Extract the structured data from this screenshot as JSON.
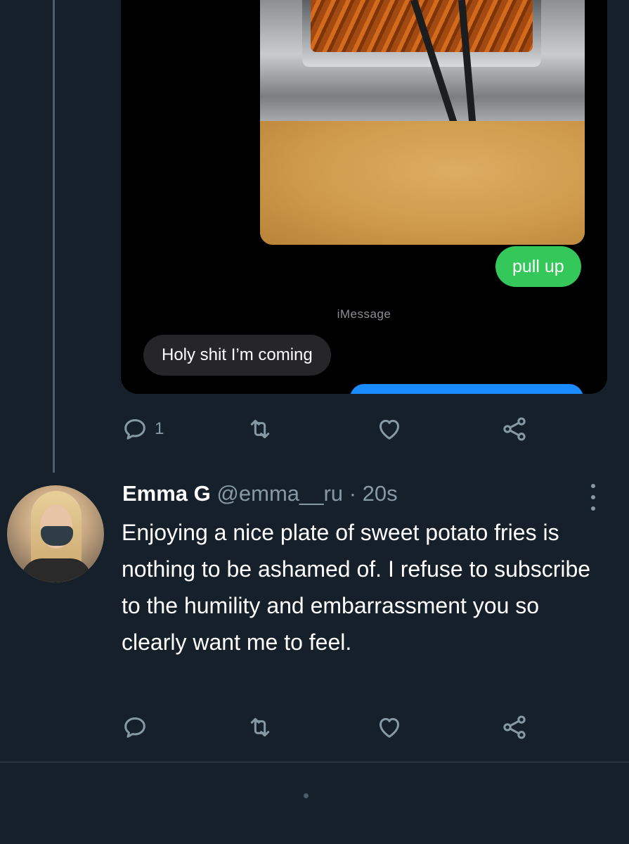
{
  "media": {
    "green_bubble": "pull up",
    "service_label": "iMessage",
    "gray_bubble": "Holy shit I’m coming"
  },
  "first_tweet_actions": {
    "reply_count": "1"
  },
  "reply_tweet": {
    "display_name": "Emma G",
    "handle": "@emma__ru",
    "separator": "·",
    "time": "20s",
    "text": "Enjoying a nice plate of sweet potato fries is nothing to be ashamed of. I refuse to subscribe to the humility and embarrassment you so clearly want me to feel."
  },
  "icons": {
    "reply": "reply-icon",
    "retweet": "retweet-icon",
    "like": "heart-icon",
    "share": "share-icon",
    "more": "more-vertical-icon"
  },
  "colors": {
    "background": "#15202b",
    "secondary_text": "#8899a6",
    "imessage_green": "#34c759",
    "imessage_blue": "#1a8cff"
  }
}
